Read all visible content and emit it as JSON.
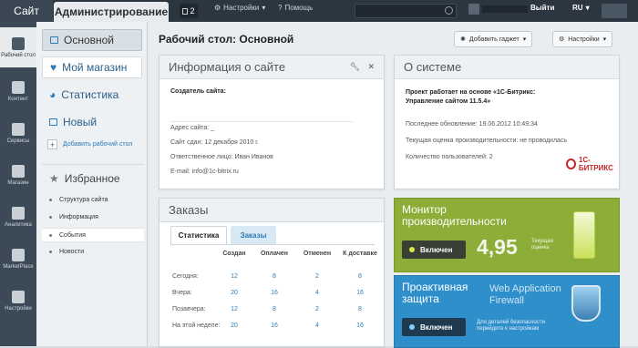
{
  "topbar": {
    "tab_site": "Сайт",
    "tab_admin": "Администрирование",
    "notifications_count": "2",
    "settings": "Настройки",
    "help": "Помощь",
    "logout": "Выйти",
    "language": "RU"
  },
  "leftnav": [
    {
      "label": "Рабочий стол",
      "icon": "desktop-icon"
    },
    {
      "label": "Контент",
      "icon": "content-icon"
    },
    {
      "label": "Сервисы",
      "icon": "services-icon"
    },
    {
      "label": "Магазин",
      "icon": "shop-icon"
    },
    {
      "label": "Аналитика",
      "icon": "analytics-icon"
    },
    {
      "label": "MarketPlace",
      "icon": "cloud-icon"
    },
    {
      "label": "Настройки",
      "icon": "gear-icon"
    }
  ],
  "sidebar": {
    "desktops": [
      "Основной",
      "Мой магазин",
      "Статистика",
      "Новый"
    ],
    "add_desktop": "Добавить рабочий стол",
    "favorites_title": "Избранное",
    "favorites": [
      "Структура сайта",
      "Информация",
      "События",
      "Новости"
    ]
  },
  "main": {
    "page_title": "Рабочий стол: Основной",
    "add_gadget": "Добавить гаджет",
    "settings": "Настройки"
  },
  "site_info": {
    "title": "Информация о сайте",
    "creator_label": "Создатель сайта:",
    "address": "Адрес сайта: _",
    "delivered": "Сайт сдан: 12 декабря 2010 г.",
    "responsible": "Ответственное лицо: Иван Иванов",
    "email": "E-mail: info@1c-bitrix.ru"
  },
  "system": {
    "title": "О системе",
    "project": "Проект работает на основе «1С-Битрикс: Управление сайтом 11.5.4»",
    "last_update": "Последнее обновление: 19.06.2012 10:49:34",
    "performance": "Текущая оценка производительности: не проводилась",
    "users": "Количество пользователей: 2",
    "logo": "1С-БИТРИКС"
  },
  "orders": {
    "title": "Заказы",
    "tabs": [
      "Статистика",
      "Заказы"
    ],
    "columns": [
      "Создан",
      "Оплачен",
      "Отменен",
      "К доставке"
    ],
    "rows": [
      {
        "label": "Сегодня:",
        "values": [
          "12",
          "8",
          "2",
          "8"
        ]
      },
      {
        "label": "Вчера:",
        "values": [
          "20",
          "16",
          "4",
          "16"
        ]
      },
      {
        "label": "Позавчера:",
        "values": [
          "12",
          "8",
          "2",
          "8"
        ]
      },
      {
        "label": "На этой неделе:",
        "values": [
          "20",
          "16",
          "4",
          "16"
        ]
      }
    ]
  },
  "monitor": {
    "title": "Монитор производительности",
    "status": "Включен",
    "score": "4,95",
    "score_label": "Текущая оценка"
  },
  "proactive": {
    "title": "Проактивная защита",
    "waf": "Web Application Firewall",
    "status": "Включен",
    "hint": "Для деталей безопасности перейдите к настройкам"
  },
  "colors": {
    "topbar": "#2b3640",
    "monitor": "#8cad38",
    "proactive": "#2f8fcb",
    "link": "#2a7ab8"
  }
}
